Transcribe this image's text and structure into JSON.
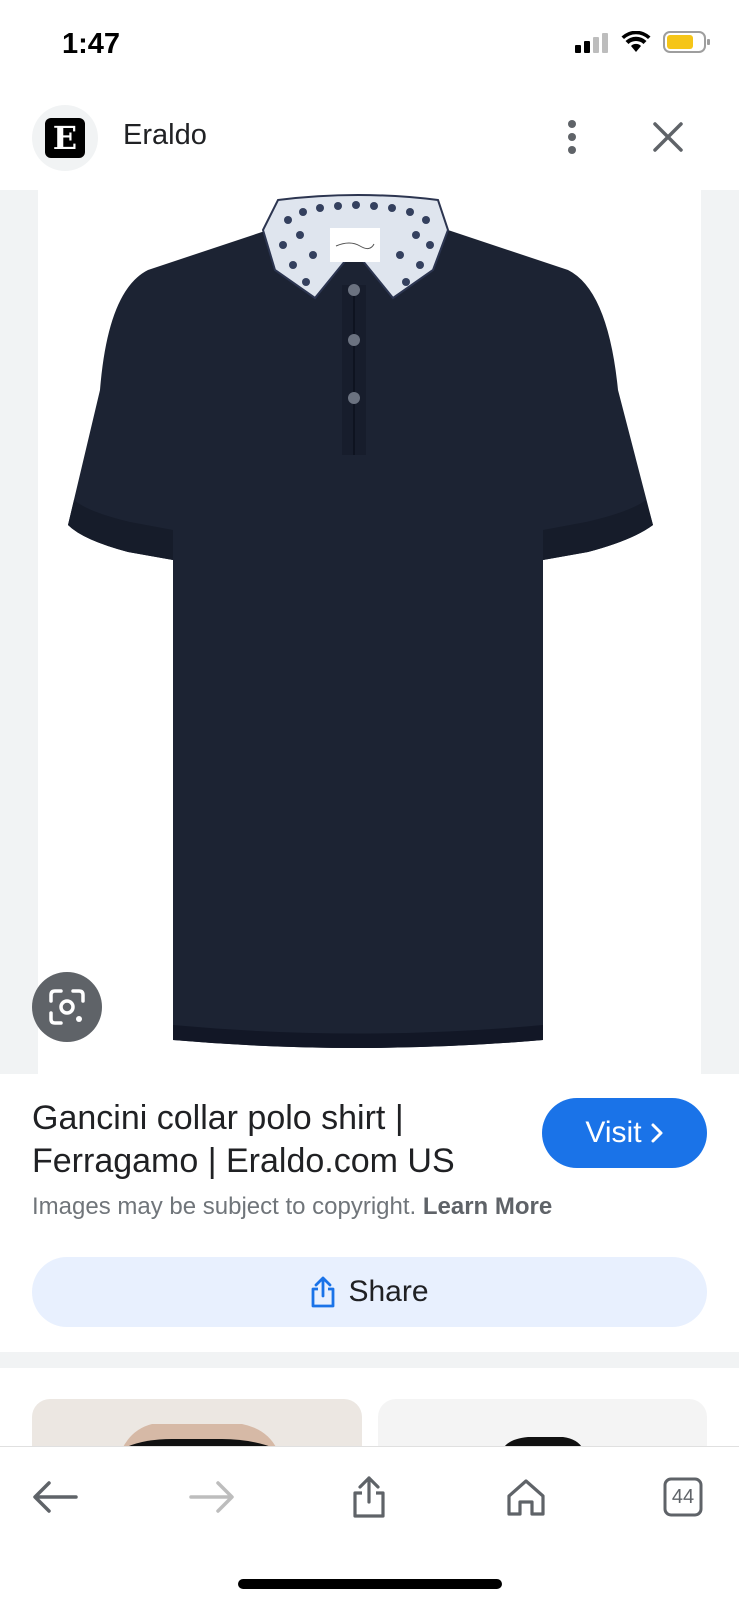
{
  "status_bar": {
    "time": "1:47",
    "battery_color": "#f5c518"
  },
  "header": {
    "logo_letter": "E",
    "site_name": "Eraldo",
    "more_icon": "more-vert-icon",
    "close_icon": "close-icon"
  },
  "image": {
    "description_icon": "polo-shirt-image",
    "lens_icon": "google-lens-icon"
  },
  "result": {
    "title": "Gancini collar polo shirt | Ferragamo | Eraldo.com US",
    "visit_label": "Visit",
    "copyright_text": "Images may be subject to copyright.",
    "learn_more_label": "Learn More",
    "share_label": "Share"
  },
  "bottom_nav": {
    "back_icon": "back-arrow-icon",
    "forward_icon": "forward-arrow-icon",
    "share_icon": "share-icon",
    "home_icon": "home-icon",
    "tab_count": "44"
  },
  "colors": {
    "accent": "#1a73e8",
    "share_bg": "#e8f0fe",
    "shirt": "#1c2333"
  }
}
